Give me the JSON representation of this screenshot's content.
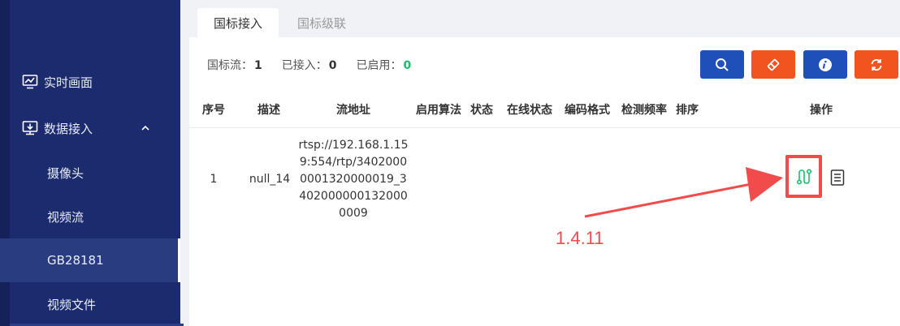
{
  "sidebar": {
    "items": [
      {
        "label": "实时画面",
        "icon": "monitor-chart-icon"
      },
      {
        "label": "数据接入",
        "icon": "desktop-download-icon",
        "expanded": true
      }
    ],
    "sub_items": [
      {
        "label": "摄像头"
      },
      {
        "label": "视频流"
      },
      {
        "label": "GB28181",
        "active": true
      },
      {
        "label": "视频文件"
      }
    ]
  },
  "tabs": [
    {
      "label": "国标接入",
      "active": true
    },
    {
      "label": "国标级联",
      "active": false
    }
  ],
  "stats": {
    "stream_label": "国标流：",
    "stream_value": "1",
    "connected_label": "已接入：",
    "connected_value": "0",
    "enabled_label": "已启用：",
    "enabled_value": "0"
  },
  "toolbar": {
    "buttons": [
      {
        "icon": "search-icon",
        "color": "#1f4fb8"
      },
      {
        "icon": "eraser-icon",
        "color": "#f2541f"
      },
      {
        "icon": "info-icon",
        "color": "#1f4fb8"
      },
      {
        "icon": "refresh-icon",
        "color": "#f2541f"
      }
    ]
  },
  "table": {
    "headers": [
      "序号",
      "描述",
      "流地址",
      "启用算法",
      "状态",
      "在线状态",
      "编码格式",
      "检测频率",
      "排序",
      "操作"
    ],
    "rows": [
      {
        "index": "1",
        "desc": "null_14",
        "url": "rtsp://192.168.1.159:554/rtp/34020000001320000019_34020000001320000009",
        "algo": "",
        "status": "",
        "online": "",
        "codec": "",
        "freq": "",
        "sort": ""
      }
    ]
  },
  "annotation": {
    "label": "1.4.11",
    "color": "#f24b4b"
  },
  "colors": {
    "sidebar": "#1b2b6d",
    "accent_blue": "#1f4fb8",
    "accent_red": "#f2541f",
    "success": "#19be6b"
  }
}
